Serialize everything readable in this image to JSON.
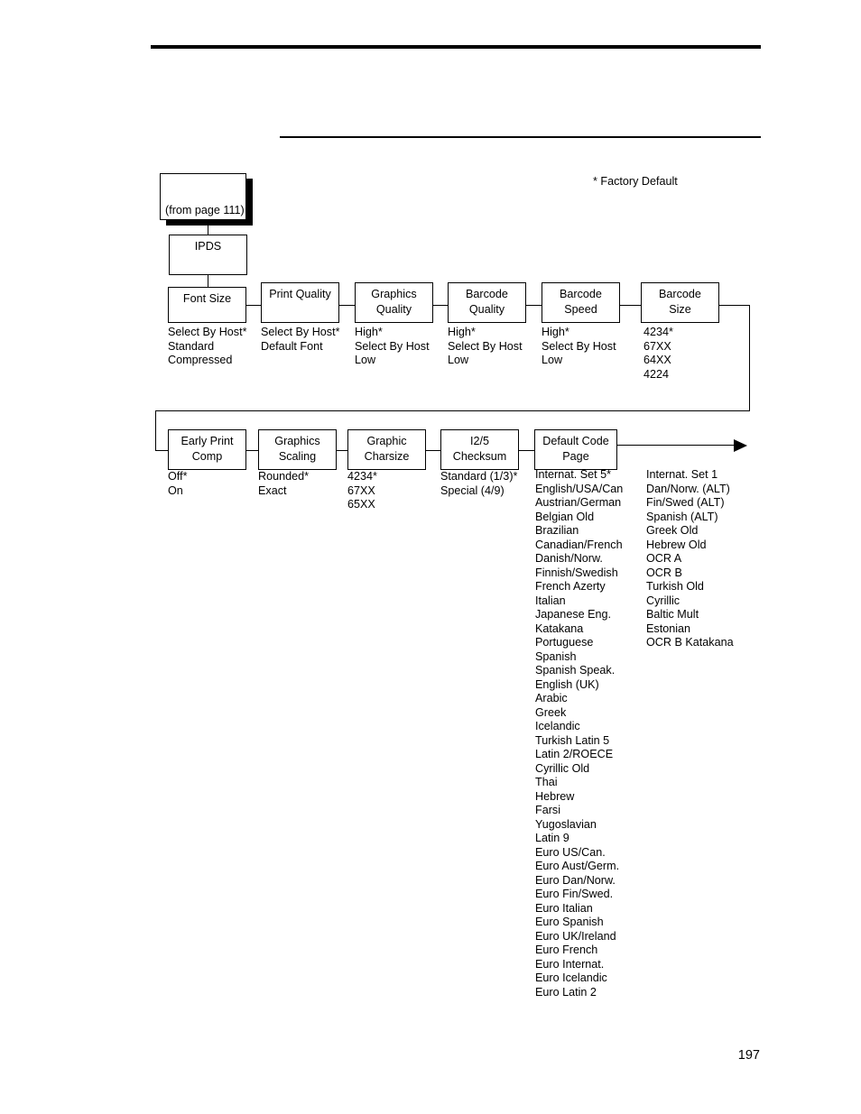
{
  "page": {
    "number": "197",
    "footnote": "* Factory Default"
  },
  "entry": {
    "from_page_label": "(from page 111)",
    "root_label": "IPDS"
  },
  "row1": [
    {
      "title": "Font Size",
      "title_lines": [
        "Font Size"
      ],
      "options": [
        "Select By Host*",
        "Standard",
        "Compressed"
      ]
    },
    {
      "title": "Print Quality",
      "title_lines": [
        "Print Quality"
      ],
      "options": [
        "Select By Host*",
        "Default Font"
      ]
    },
    {
      "title": "Graphics Quality",
      "title_lines": [
        "Graphics",
        "Quality"
      ],
      "options": [
        "High*",
        "Select By Host",
        "Low"
      ]
    },
    {
      "title": "Barcode Quality",
      "title_lines": [
        "Barcode",
        "Quality"
      ],
      "options": [
        "High*",
        "Select By Host",
        "Low"
      ]
    },
    {
      "title": "Barcode Speed",
      "title_lines": [
        "Barcode",
        "Speed"
      ],
      "options": [
        "High*",
        "Select By Host",
        "Low"
      ]
    },
    {
      "title": "Barcode Size",
      "title_lines": [
        "Barcode",
        "Size"
      ],
      "options": [
        "4234*",
        "67XX",
        "64XX",
        "4224"
      ]
    }
  ],
  "row2": [
    {
      "title": "Early Print Comp",
      "title_lines": [
        "Early Print",
        "Comp"
      ],
      "options": [
        "Off*",
        "On"
      ]
    },
    {
      "title": "Graphics Scaling",
      "title_lines": [
        "Graphics",
        "Scaling"
      ],
      "options": [
        "Rounded*",
        "Exact"
      ]
    },
    {
      "title": "Graphic Charsize",
      "title_lines": [
        "Graphic",
        "Charsize"
      ],
      "options": [
        "4234*",
        "67XX",
        "65XX"
      ]
    },
    {
      "title": "I2/5 Checksum",
      "title_lines": [
        "I2/5",
        "Checksum"
      ],
      "options": [
        "Standard (1/3)*",
        "Special (4/9)"
      ]
    },
    {
      "title": "Default Code Page",
      "title_lines": [
        "Default Code",
        "Page"
      ],
      "options": [],
      "options_col1": [
        "Internat. Set 5*",
        "English/USA/Can",
        "Austrian/German",
        "Belgian Old",
        "Brazilian",
        "Canadian/French",
        "Danish/Norw.",
        "Finnish/Swedish",
        "French Azerty",
        "Italian",
        "Japanese Eng.",
        "Katakana",
        "Portuguese",
        "Spanish",
        "Spanish Speak.",
        "English (UK)",
        "Arabic",
        "Greek",
        "Icelandic",
        "Turkish Latin 5",
        "Latin 2/ROECE",
        "Cyrillic Old",
        "Thai",
        "Hebrew",
        "Farsi",
        "Yugoslavian",
        "Latin 9",
        "Euro US/Can.",
        "Euro Aust/Germ.",
        "Euro Dan/Norw.",
        "Euro Fin/Swed.",
        "Euro Italian",
        "Euro Spanish",
        "Euro UK/Ireland",
        "Euro French",
        "Euro Internat.",
        "Euro Icelandic",
        "Euro Latin 2"
      ],
      "options_col2": [
        "Internat. Set 1",
        "Dan/Norw. (ALT)",
        "Fin/Swed (ALT)",
        "Spanish (ALT)",
        "Greek Old",
        "Hebrew Old",
        "OCR A",
        "OCR B",
        "Turkish Old",
        "Cyrillic",
        "Baltic Mult",
        "Estonian",
        "OCR B Katakana"
      ]
    }
  ]
}
